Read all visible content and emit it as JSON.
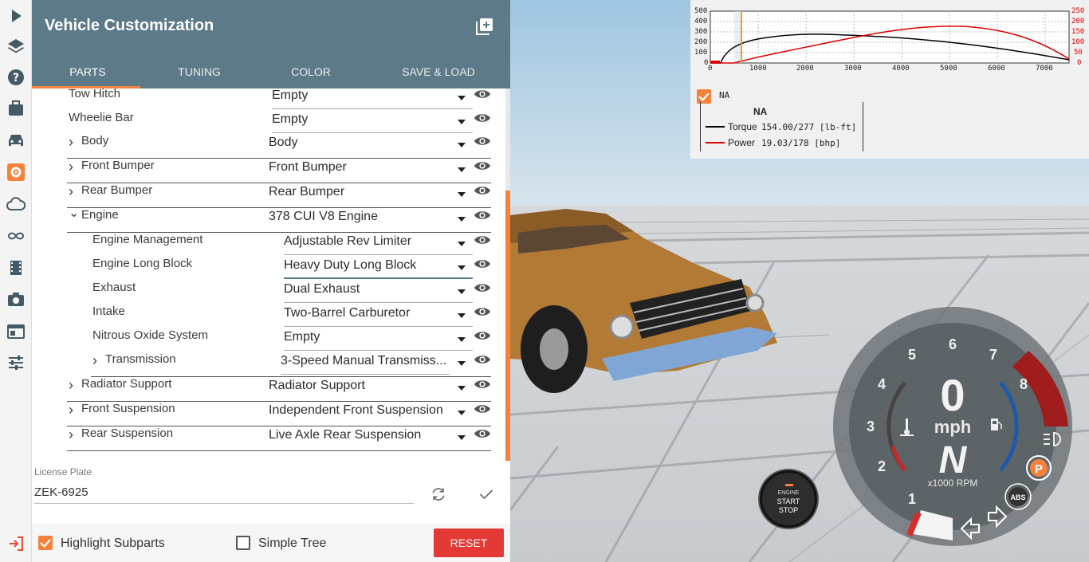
{
  "panel": {
    "title": "Vehicle Customization",
    "tabs": [
      "PARTS",
      "TUNING",
      "COLOR",
      "SAVE & LOAD"
    ]
  },
  "parts": [
    {
      "label": "Tow Hitch",
      "value": "Empty",
      "level": 0,
      "expand": ""
    },
    {
      "label": "Wheelie Bar",
      "value": "Empty",
      "level": 0,
      "expand": ""
    },
    {
      "label": "Body",
      "value": "Body",
      "level": 0,
      "expand": "›"
    },
    {
      "label": "Front Bumper",
      "value": "Front Bumper",
      "level": 0,
      "expand": "›"
    },
    {
      "label": "Rear Bumper",
      "value": "Rear Bumper",
      "level": 0,
      "expand": "›"
    },
    {
      "label": "Engine",
      "value": "378 CUI V8 Engine",
      "level": 0,
      "expand": "⌄"
    },
    {
      "label": "Engine Management",
      "value": "Adjustable Rev Limiter",
      "level": 1,
      "expand": ""
    },
    {
      "label": "Engine Long Block",
      "value": "Heavy Duty Long Block",
      "level": 1,
      "expand": ""
    },
    {
      "label": "Exhaust",
      "value": "Dual Exhaust",
      "level": 1,
      "expand": ""
    },
    {
      "label": "Intake",
      "value": "Two-Barrel Carburetor",
      "level": 1,
      "expand": ""
    },
    {
      "label": "Nitrous Oxide System",
      "value": "Empty",
      "level": 1,
      "expand": ""
    },
    {
      "label": "Transmission",
      "value": "3-Speed Manual Transmiss...",
      "level": 1,
      "expand": "›"
    },
    {
      "label": "Radiator Support",
      "value": "Radiator Support",
      "level": 0,
      "expand": "›"
    },
    {
      "label": "Front Suspension",
      "value": "Independent Front Suspension",
      "level": 0,
      "expand": "›"
    },
    {
      "label": "Rear Suspension",
      "value": "Live Axle Rear Suspension",
      "level": 0,
      "expand": "›"
    }
  ],
  "license": {
    "label": "License Plate",
    "value": "ZEK-6925"
  },
  "footer": {
    "highlight_label": "Highlight Subparts",
    "highlight_checked": true,
    "simple_tree_label": "Simple Tree",
    "simple_tree_checked": false,
    "reset_label": "RESET"
  },
  "graph": {
    "left_ticks": [
      "500",
      "400",
      "300",
      "200",
      "100",
      "0"
    ],
    "right_ticks": [
      "250",
      "200",
      "150",
      "100",
      "50",
      "0"
    ],
    "x_ticks": [
      "0",
      "1000",
      "2000",
      "3000",
      "4000",
      "5000",
      "6000",
      "7000"
    ],
    "checkbox_label": "NA",
    "legend_title": "NA",
    "torque_label": "Torque",
    "torque_value": "154.00/277 [lb-ft]",
    "power_label": "Power",
    "power_value": "19.03/178  [bhp]"
  },
  "gauge": {
    "speed": "0",
    "unit": "mph",
    "gear": "N",
    "rpm_label": "x1000 RPM",
    "numbers": [
      "1",
      "2",
      "3",
      "4",
      "5",
      "6",
      "7",
      "8"
    ],
    "abs_label": "ABS",
    "parking_label": "P"
  },
  "engine_button": {
    "line1": "ENGINE",
    "line2": "START",
    "line3": "STOP"
  },
  "colors": {
    "accent": "#f5813b",
    "header": "#5d7a88",
    "reset": "#e53935"
  }
}
